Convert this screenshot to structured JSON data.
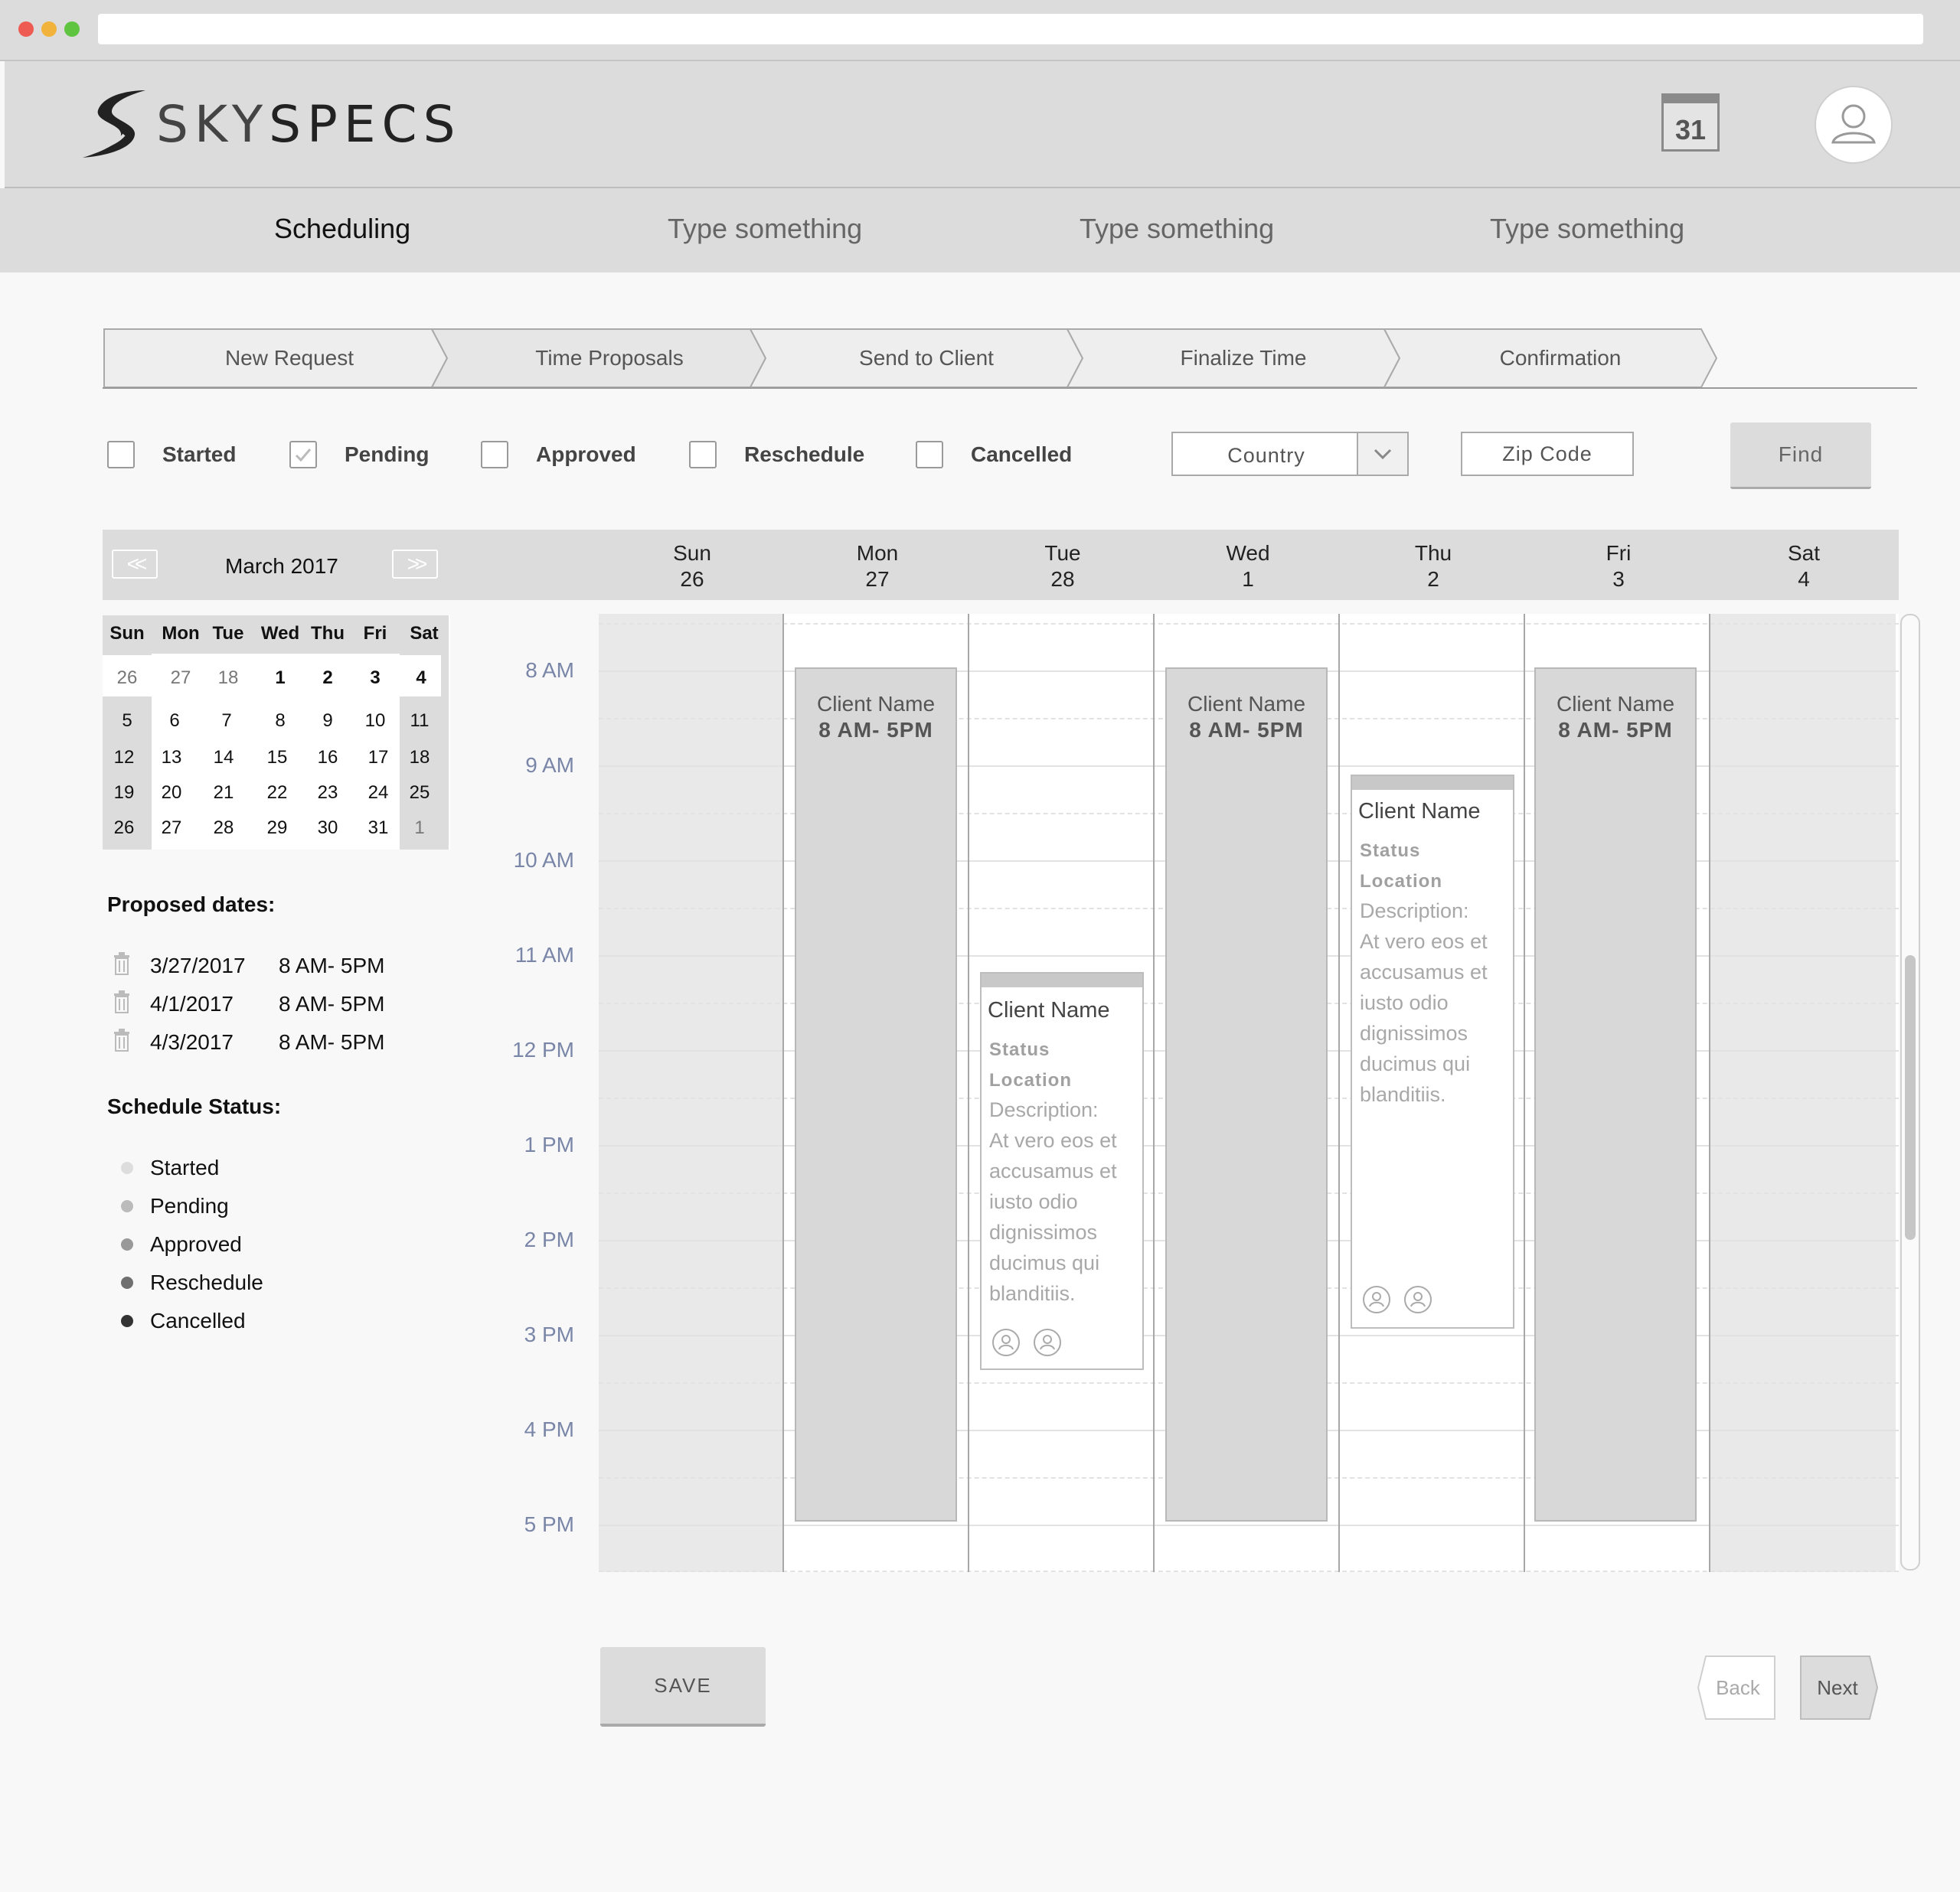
{
  "brand": {
    "logo_light": "SKY",
    "logo_bold": "SPECS"
  },
  "header": {
    "calendar_icon_day": "31"
  },
  "nav": {
    "items": [
      {
        "label": "Scheduling",
        "active": true
      },
      {
        "label": "Type something",
        "active": false
      },
      {
        "label": "Type something",
        "active": false
      },
      {
        "label": "Type something",
        "active": false
      }
    ]
  },
  "steps": [
    "New Request",
    "Time Proposals",
    "Send to Client",
    "Finalize Time",
    "Confirmation"
  ],
  "filters": {
    "checkboxes": [
      {
        "label": "Started",
        "checked": false
      },
      {
        "label": "Pending",
        "checked": true
      },
      {
        "label": "Approved",
        "checked": false
      },
      {
        "label": "Reschedule",
        "checked": false
      },
      {
        "label": "Cancelled",
        "checked": false
      }
    ],
    "country_placeholder": "Country",
    "zip_placeholder": "Zip Code",
    "find_label": "Find"
  },
  "mini_calendar": {
    "month_label": "March 2017",
    "prev_label": "<<",
    "next_label": ">>",
    "weekdays": [
      "Sun",
      "Mon",
      "Tue",
      "Wed",
      "Thu",
      "Fri",
      "Sat"
    ],
    "weeks": [
      [
        "26",
        "27",
        "18",
        "1",
        "2",
        "3",
        "4"
      ],
      [
        "5",
        "6",
        "7",
        "8",
        "9",
        "10",
        "11"
      ],
      [
        "12",
        "13",
        "14",
        "15",
        "16",
        "17",
        "18"
      ],
      [
        "19",
        "20",
        "21",
        "22",
        "23",
        "24",
        "25"
      ],
      [
        "26",
        "27",
        "28",
        "29",
        "30",
        "31",
        "1"
      ]
    ]
  },
  "proposed": {
    "title": "Proposed dates:",
    "items": [
      {
        "date": "3/27/2017",
        "time": "8 AM- 5PM"
      },
      {
        "date": "4/1/2017",
        "time": "8 AM- 5PM"
      },
      {
        "date": "4/3/2017",
        "time": "8 AM- 5PM"
      }
    ]
  },
  "schedule_status": {
    "title": "Schedule Status:",
    "items": [
      {
        "label": "Started",
        "color": "#dddddd"
      },
      {
        "label": "Pending",
        "color": "#bbbbbb"
      },
      {
        "label": "Approved",
        "color": "#999999"
      },
      {
        "label": "Reschedule",
        "color": "#6f6f6f"
      },
      {
        "label": "Cancelled",
        "color": "#333333"
      }
    ]
  },
  "week": {
    "days": [
      {
        "name": "Sun",
        "date": "26"
      },
      {
        "name": "Mon",
        "date": "27"
      },
      {
        "name": "Tue",
        "date": "28"
      },
      {
        "name": "Wed",
        "date": "1"
      },
      {
        "name": "Thu",
        "date": "2"
      },
      {
        "name": "Fri",
        "date": "3"
      },
      {
        "name": "Sat",
        "date": "4"
      }
    ],
    "hours": [
      "8 AM",
      "9 AM",
      "10 AM",
      "11 AM",
      "12 PM",
      "1 PM",
      "2 PM",
      "3 PM",
      "4 PM",
      "5 PM"
    ]
  },
  "events": {
    "mon": {
      "name": "Client Name",
      "time": "8 AM- 5PM"
    },
    "wed": {
      "name": "Client Name",
      "time": "8 AM- 5PM"
    },
    "fri": {
      "name": "Client Name",
      "time": "8 AM- 5PM"
    },
    "tue_card": {
      "name": "Client Name",
      "status": "Status",
      "location": "Location",
      "description_label": "Description:",
      "description": "At vero eos et accusamus et iusto odio dignissimos ducimus qui blanditiis."
    },
    "thu_card": {
      "name": "Client Name",
      "status": "Status",
      "location": "Location",
      "description_label": "Description:",
      "description": "At vero eos et accusamus et iusto odio dignissimos ducimus qui blanditiis."
    }
  },
  "actions": {
    "save_label": "SAVE",
    "back_label": "Back",
    "next_label": "Next"
  }
}
